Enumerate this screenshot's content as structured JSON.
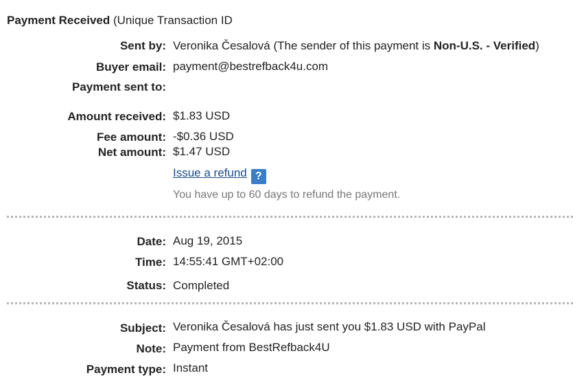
{
  "header": {
    "title_bold": "Payment Received",
    "title_rest": " (Unique Transaction ID"
  },
  "sent_by": {
    "label": "Sent by:",
    "name": "Veronika Česalová",
    "note_prefix": " (The sender of this payment is ",
    "note_bold": "Non-U.S. - Verified",
    "note_suffix": ")"
  },
  "buyer_email": {
    "label": "Buyer email:",
    "value": "payment@bestrefback4u.com"
  },
  "payment_sent_to": {
    "label": "Payment sent to:",
    "value": ""
  },
  "amount_received": {
    "label": "Amount received:",
    "value": "$1.83 USD"
  },
  "fee_amount": {
    "label": "Fee amount:",
    "value": "-$0.36 USD"
  },
  "net_amount": {
    "label": "Net amount:",
    "value": "$1.47 USD"
  },
  "refund": {
    "link_text": "Issue a refund",
    "help_icon": "?",
    "hint": "You have up to 60 days to refund the payment."
  },
  "date": {
    "label": "Date:",
    "value": "Aug 19, 2015"
  },
  "time": {
    "label": "Time:",
    "value": "14:55:41 GMT+02:00"
  },
  "status": {
    "label": "Status:",
    "value": "Completed"
  },
  "subject": {
    "label": "Subject:",
    "value": "Veronika Česalová has just sent you $1.83 USD with PayPal"
  },
  "note": {
    "label": "Note:",
    "value": "Payment from BestRefback4U"
  },
  "payment_type": {
    "label": "Payment type:",
    "value": "Instant"
  },
  "colors": {
    "link": "#1a4c8a",
    "help_icon_bg": "#3a7ec8",
    "hint_text": "#777777",
    "divider": "#b5b5b5"
  }
}
